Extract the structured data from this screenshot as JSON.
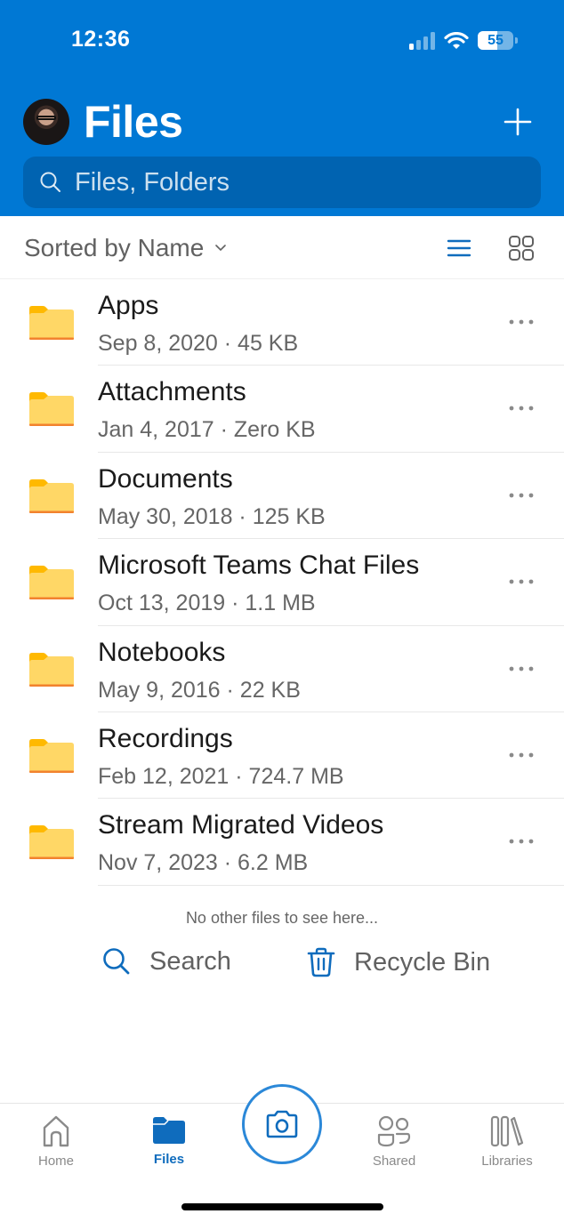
{
  "status_bar": {
    "time": "12:36",
    "battery_percent": "55",
    "signal_bars_active": 1,
    "signal_bars_total": 4
  },
  "header": {
    "title": "Files",
    "add_icon": "plus-icon",
    "avatar_icon": "user-avatar"
  },
  "search": {
    "placeholder": "Files, Folders",
    "value": "",
    "icon": "search-icon"
  },
  "sort": {
    "label": "Sorted by Name",
    "chevron_icon": "chevron-down-icon",
    "view_modes": [
      {
        "name": "list-view",
        "icon": "list-icon",
        "active": true
      },
      {
        "name": "grid-view",
        "icon": "grid-icon",
        "active": false
      }
    ]
  },
  "files": [
    {
      "name": "Apps",
      "date": "Sep 8, 2020",
      "size": "45 KB",
      "meta": "Sep 8, 2020 · 45 KB",
      "type": "folder"
    },
    {
      "name": "Attachments",
      "date": "Jan 4, 2017",
      "size": "Zero KB",
      "meta": "Jan 4, 2017 · Zero KB",
      "type": "folder"
    },
    {
      "name": "Documents",
      "date": "May 30, 2018",
      "size": "125 KB",
      "meta": "May 30, 2018 · 125 KB",
      "type": "folder"
    },
    {
      "name": "Microsoft Teams Chat Files",
      "date": "Oct 13, 2019",
      "size": "1.1 MB",
      "meta": "Oct 13, 2019 · 1.1 MB",
      "type": "folder"
    },
    {
      "name": "Notebooks",
      "date": "May 9, 2016",
      "size": "22 KB",
      "meta": "May 9, 2016 · 22 KB",
      "type": "folder"
    },
    {
      "name": "Recordings",
      "date": "Feb 12, 2021",
      "size": "724.7 MB",
      "meta": "Feb 12, 2021 · 724.7 MB",
      "type": "folder"
    },
    {
      "name": "Stream Migrated Videos",
      "date": "Nov 7, 2023",
      "size": "6.2 MB",
      "meta": "Nov 7, 2023 · 6.2 MB",
      "type": "folder"
    }
  ],
  "footer": {
    "empty_note": "No other files to see here...",
    "search_label": "Search",
    "recycle_label": "Recycle Bin"
  },
  "tabs": [
    {
      "label": "Home",
      "icon": "home-icon",
      "active": false
    },
    {
      "label": "Files",
      "icon": "folder-icon",
      "active": true
    },
    {
      "label": "Shared",
      "icon": "shared-icon",
      "active": false
    },
    {
      "label": "Libraries",
      "icon": "libraries-icon",
      "active": false
    }
  ],
  "camera": {
    "icon": "camera-icon"
  },
  "colors": {
    "brand_blue": "#0078d4",
    "search_bg": "#0063b1",
    "accent": "#0f6cbd",
    "folder_body": "#ffd766",
    "folder_tab": "#ffb900",
    "folder_edge": "#f2822e"
  }
}
